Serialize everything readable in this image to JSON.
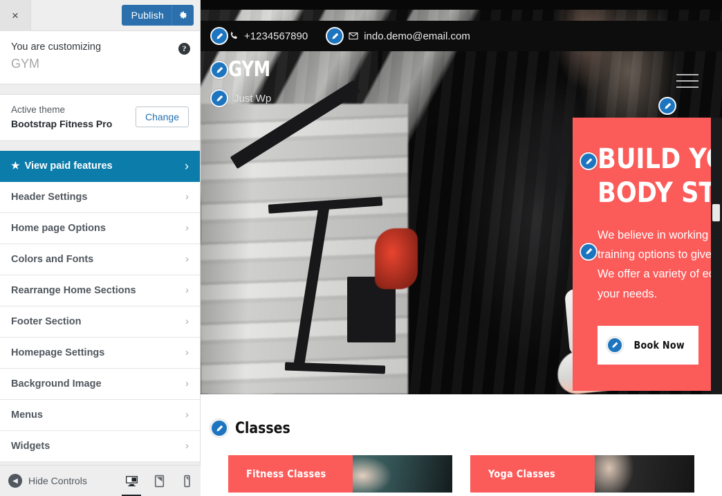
{
  "customizer": {
    "close_label": "×",
    "publish_label": "Publish",
    "gear_icon": "gear-icon",
    "help_icon": "?",
    "customizing_label": "You are customizing",
    "site_title": "GYM",
    "active_theme_label": "Active theme",
    "active_theme_name": "Bootstrap Fitness Pro",
    "change_label": "Change",
    "items": [
      {
        "label": "View paid features",
        "star": "★",
        "chevron": "›",
        "highlighted": true
      },
      {
        "label": "Header Settings",
        "chevron": "›"
      },
      {
        "label": "Home page Options",
        "chevron": "›"
      },
      {
        "label": "Colors and Fonts",
        "chevron": "›"
      },
      {
        "label": "Rearrange Home Sections",
        "chevron": "›"
      },
      {
        "label": "Footer Section",
        "chevron": "›"
      },
      {
        "label": "Homepage Settings",
        "chevron": "›"
      },
      {
        "label": "Background Image",
        "chevron": "›"
      },
      {
        "label": "Menus",
        "chevron": "›"
      },
      {
        "label": "Widgets",
        "chevron": "›"
      }
    ],
    "hide_controls_label": "Hide Controls",
    "hide_controls_arrow": "◀",
    "devices": [
      {
        "name": "desktop",
        "active": true
      },
      {
        "name": "tablet",
        "active": false
      },
      {
        "name": "mobile",
        "active": false
      }
    ],
    "accent_blue": "#0c7cab",
    "publish_blue": "#2b70ad"
  },
  "preview": {
    "contact": {
      "phone_icon": "phone-icon",
      "phone": "+1234567890",
      "email_icon": "envelope-icon",
      "email": "indo.demo@email.com"
    },
    "brand": "GYM",
    "tagline": "Just Wp",
    "menu_icon": "hamburger-menu-icon",
    "hero": {
      "heading": "Build Your Body Strong",
      "paragraph": "We believe in working the body with a variety of training options to give you the best results possible. We offer a variety of equipment and programs to suit your needs.",
      "cta_label": "Book Now",
      "bg_color": "#fb5b59"
    },
    "classes": {
      "title": "Classes",
      "cards": [
        {
          "label": "Fitness Classes"
        },
        {
          "label": "Yoga Classes"
        }
      ]
    },
    "edit_icon": "pencil-edit-icon"
  }
}
